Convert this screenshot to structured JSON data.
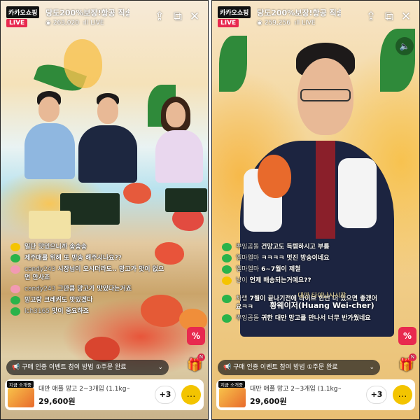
{
  "panels": [
    {
      "brand": "카카오쇼핑",
      "live_badge": "LIVE",
      "title": "당도200%보장!항공 직송 대만 망고",
      "viewers": "263,020",
      "live_text": "LIVE",
      "chat": [
        {
          "nick": "",
          "text": "일단 맛있으니까 송송송",
          "color": "#f5c400"
        },
        {
          "nick": "",
          "text": "제주매를 위해 또 방송 해주시나요??",
          "color": "#2ab34a"
        },
        {
          "nick": "candy243",
          "text": "시장님이 오시더라도.. 망고가 맛이 없으",
          "color": "#f29ab3"
        },
        {
          "nick": "",
          "text": "면 안사죠",
          "color": ""
        },
        {
          "nick": "candy243",
          "text": "그만큼 망고가 맛있다는거죠",
          "color": "#f29ab3"
        },
        {
          "nick": "",
          "text": "망고랑 크레커도 맛있겠다",
          "color": "#2ab34a"
        },
        {
          "nick": "lch3165",
          "text": "맛이 중요하죠",
          "color": "#2ab34a"
        }
      ],
      "notice": "구매 인증 이벤트 참여 방법 ①주문 완료",
      "product": {
        "badge": "지금 소개중",
        "name": "대만 애플 망고 2~3개입 (1.1kg~",
        "price": "29,600원",
        "more": "+3"
      }
    },
    {
      "brand": "카카오쇼핑",
      "live_badge": "LIVE",
      "title": "당도200%보장!항공 직송 대만 망고",
      "viewers": "259,256",
      "live_text": "LIVE",
      "caption_sub": "대만 타이난시시장",
      "caption_main": "황웨이저(Huang Wei-cher)",
      "chat": [
        {
          "nick": "뿌잉곰돌",
          "text": "건망고도 득템하시고 부름",
          "color": "#2ab34a"
        },
        {
          "nick": "엘마엘마",
          "text": "ㅋㅋㅋㅋ 멋진 방송이네요",
          "color": "#2ab34a"
        },
        {
          "nick": "엘마엘마",
          "text": "6~7월이 제철",
          "color": "#2ab34a"
        },
        {
          "nick": "냥이",
          "text": "언제 배송되는거예요??",
          "color": "#f5c400"
        },
        {
          "nick": "차랭",
          "text": "7월이 끝나기전에 라이브 한번 더 있으면 좋겠어",
          "color": "#2ab34a"
        },
        {
          "nick": "",
          "text": "요ㅋㅋ",
          "color": ""
        },
        {
          "nick": "뿌잉곰돌",
          "text": "귀한 대만 망고를 만나서 너무 반가웠네요",
          "color": "#2ab34a"
        }
      ],
      "notice": "구매 인증 이벤트 참여 방법 ①주문 완료",
      "product": {
        "badge": "지금 소개중",
        "name": "대만 애플 망고 2~3개입 (1.1kg~",
        "price": "29,600원",
        "more": "+3"
      }
    }
  ],
  "icons": [
    "share-icon",
    "pip-icon",
    "close-icon",
    "sound-icon",
    "gift-icon",
    "coupon-icon",
    "chat-icon",
    "megaphone-icon"
  ],
  "colors": {
    "live": "#e8294f",
    "chat_bubble": "#f3c400"
  }
}
